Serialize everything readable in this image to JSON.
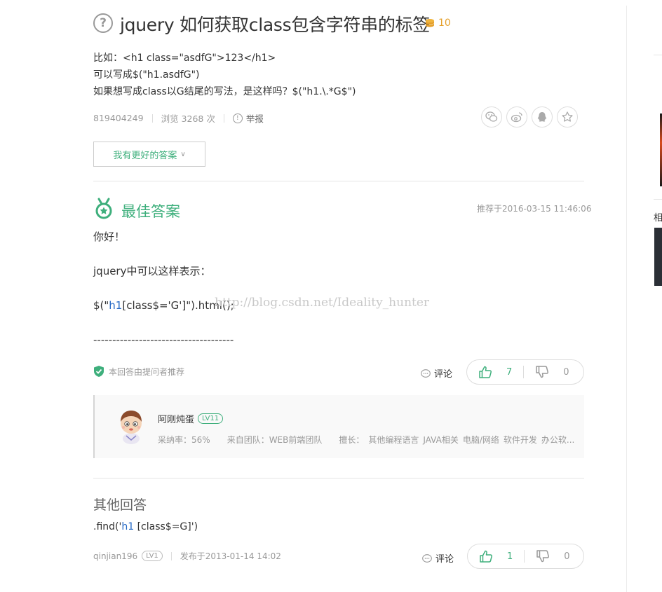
{
  "question": {
    "title": "jquery 如何获取class包含字符串的标签",
    "reward": "10",
    "body": [
      "比如：<h1 class=\"asdfG\">123</h1>",
      "可以写成$(\"h1.asdfG\")",
      "如果想写成class以G结尾的写法，是这样吗？$(\"h1.\\.*G$\")"
    ],
    "author": "819404249",
    "views": "浏览 3268 次",
    "report": "举报",
    "better_answer_btn": "我有更好的答案"
  },
  "best_answer": {
    "heading": "最佳答案",
    "recommended_time": "推荐于2016-03-15 11:46:06",
    "lines": {
      "greet": "你好！",
      "intro": "jquery中可以这样表示：",
      "code_pre": "$(\"",
      "code_tag": "h1",
      "code_post": "[class$='G']\").html();",
      "dashes": "-------------------------------------"
    },
    "watermark": "http://blog.csdn.net/Ideality_hunter",
    "recommended_by": "本回答由提问者推荐",
    "comment_label": "评论",
    "upvotes": "7",
    "downvotes": "0",
    "answerer": {
      "name": "阿刚炖蛋",
      "level": "LV11",
      "accept_rate": "采纳率：56%",
      "team": "来自团队：WEB前端团队",
      "expertise_label": "擅长：",
      "expertise": [
        "其他编程语言",
        "JAVA相关",
        "电脑/网络",
        "软件开发",
        "办公软..."
      ]
    }
  },
  "other_answers": {
    "heading": "其他回答",
    "items": [
      {
        "body_pre": ".find('",
        "body_tag": "h1",
        "body_post": " [class$=G]')",
        "author": "qinjian196",
        "level": "LV1",
        "time": "发布于2013-01-14 14:02",
        "comment_label": "评论",
        "upvotes": "1",
        "downvotes": "0"
      }
    ]
  },
  "sidebar": {
    "partial_text": "相"
  },
  "colors": {
    "accent": "#3eaf7c",
    "coin": "#e5a02a",
    "code": "#2468c5"
  },
  "icons": [
    "question-icon",
    "coin-icon",
    "info-icon",
    "wechat-icon",
    "weibo-icon",
    "qq-icon",
    "star-icon",
    "medal-icon",
    "shield-check-icon",
    "comment-icon",
    "thumb-up-icon",
    "thumb-down-icon"
  ]
}
